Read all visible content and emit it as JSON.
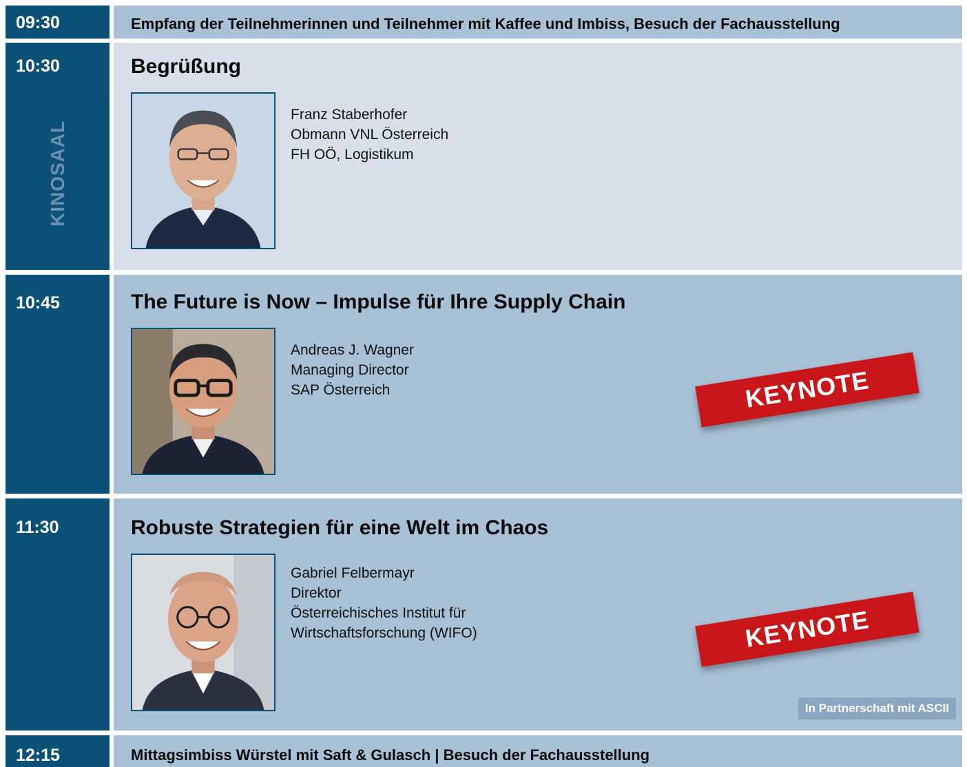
{
  "room_label": "KINOSAAL",
  "rows": {
    "arrival": {
      "time": "09:30",
      "text": "Empfang der Teilnehmerinnen und Teilnehmer mit Kaffee und Imbiss, Besuch der Fachausstellung"
    },
    "welcome": {
      "time": "10:30",
      "title": "Begrüßung",
      "photo_icon": "speaker-photo-staberhofer",
      "speaker": [
        "Franz Staberhofer",
        "Obmann VNL Österreich",
        "FH OÖ, Logistikum"
      ]
    },
    "future": {
      "time": "10:45",
      "title": "The Future is Now – Impulse für Ihre Supply Chain",
      "photo_icon": "speaker-photo-wagner",
      "speaker": [
        "Andreas J. Wagner",
        "Managing Director",
        "SAP Österreich"
      ],
      "badge": "KEYNOTE"
    },
    "robust": {
      "time": "11:30",
      "title": "Robuste Strategien für eine Welt im Chaos",
      "photo_icon": "speaker-photo-felbermayr",
      "speaker": [
        "Gabriel Felbermayr",
        "Direktor",
        "Österreichisches Institut für",
        "Wirtschaftsforschung (WIFO)"
      ],
      "badge": "KEYNOTE",
      "partner_note": "In Partnerschaft mit ASCII"
    },
    "lunch": {
      "time": "12:15",
      "text": "Mittagsimbiss Würstel mit Saft & Gulasch | Besuch der Fachausstellung"
    }
  },
  "colors": {
    "time_column": "#0b5177",
    "light_band": "#d8dfea",
    "mid_band": "#a9c1d7",
    "keynote_red": "#c8161a",
    "room_label": "#6d8fb0"
  }
}
